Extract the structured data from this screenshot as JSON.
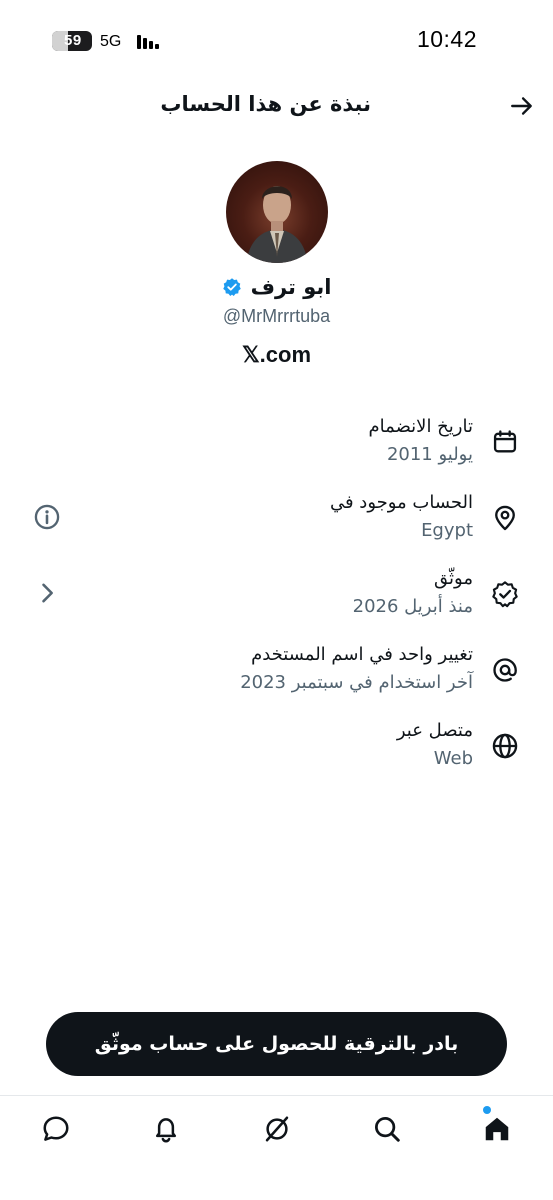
{
  "status_bar": {
    "battery": "59",
    "network": "5G",
    "time": "10:42"
  },
  "header": {
    "title": "نبذة عن هذا الحساب",
    "back_icon": "arrow-right-icon"
  },
  "profile": {
    "display_name": "ابو ترف",
    "handle": "@MrMrrrtuba",
    "site": "𝕏.com",
    "verified_color": "#1d9bf0"
  },
  "info_rows": [
    {
      "icon": "calendar-icon",
      "title": "تاريخ الانضمام",
      "value": "يوليو 2011"
    },
    {
      "icon": "location-pin-icon",
      "title": "الحساب موجود في",
      "value": "Egypt",
      "side": "info-circle-icon"
    },
    {
      "icon": "verified-badge-icon",
      "title": "موثّق",
      "value": "منذ أبريل 2026",
      "side": "chevron-left-icon"
    },
    {
      "icon": "at-sign-icon",
      "title": "تغيير واحد في اسم المستخدم",
      "value": "آخر استخدام في سبتمبر 2023"
    },
    {
      "icon": "globe-icon",
      "title": "متصل عبر",
      "value": "Web"
    }
  ],
  "upgrade_button": {
    "label": "بادر بالترقية للحصول على حساب موثّق"
  },
  "bottom_nav": {
    "items": [
      "chat-icon",
      "bell-icon",
      "grok-icon",
      "search-icon",
      "home-icon"
    ],
    "accent": "#1d9bf0"
  }
}
